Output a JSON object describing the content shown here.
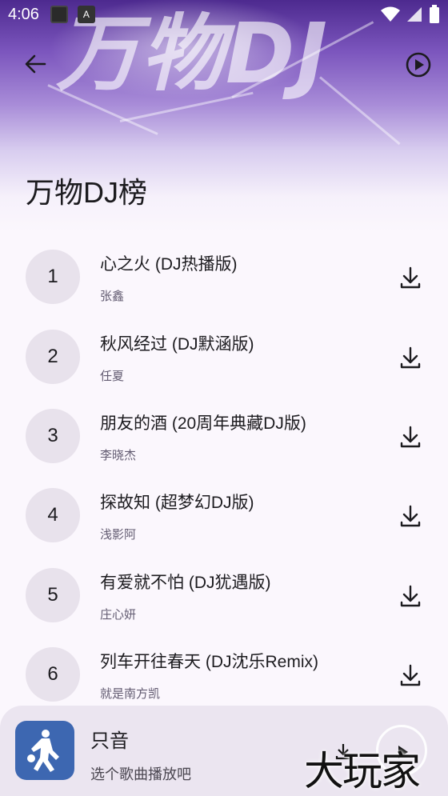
{
  "status_bar": {
    "time": "4:06"
  },
  "header": {
    "banner_text": "万物DJ",
    "title": "万物DJ榜"
  },
  "songs": [
    {
      "rank": "1",
      "title": "心之火 (DJ热播版)",
      "artist": "张鑫"
    },
    {
      "rank": "2",
      "title": "秋风经过 (DJ默涵版)",
      "artist": "任夏"
    },
    {
      "rank": "3",
      "title": "朋友的酒 (20周年典藏DJ版)",
      "artist": "李晓杰"
    },
    {
      "rank": "4",
      "title": "探故知 (超梦幻DJ版)",
      "artist": "浅影阿"
    },
    {
      "rank": "5",
      "title": "有爱就不怕 (DJ犹遇版)",
      "artist": "庄心妍"
    },
    {
      "rank": "6",
      "title": "列车开往春天 (DJ沈乐Remix)",
      "artist": "就是南方凯"
    }
  ],
  "player": {
    "title": "只音",
    "subtitle": "选个歌曲播放吧"
  },
  "watermark": "大玩家",
  "colors": {
    "header_top": "#4d2a8f",
    "background": "#fbf7fd",
    "rank_circle": "#e8e2ec",
    "player_bar": "#ebe5f0",
    "cover": "#3d67b1"
  },
  "icons": {
    "back": "arrow-left-icon",
    "play_all": "play-circle-icon",
    "download": "download-icon",
    "wifi": "wifi-icon",
    "signal": "signal-icon",
    "battery": "battery-icon",
    "cover": "basketball-player-icon"
  }
}
